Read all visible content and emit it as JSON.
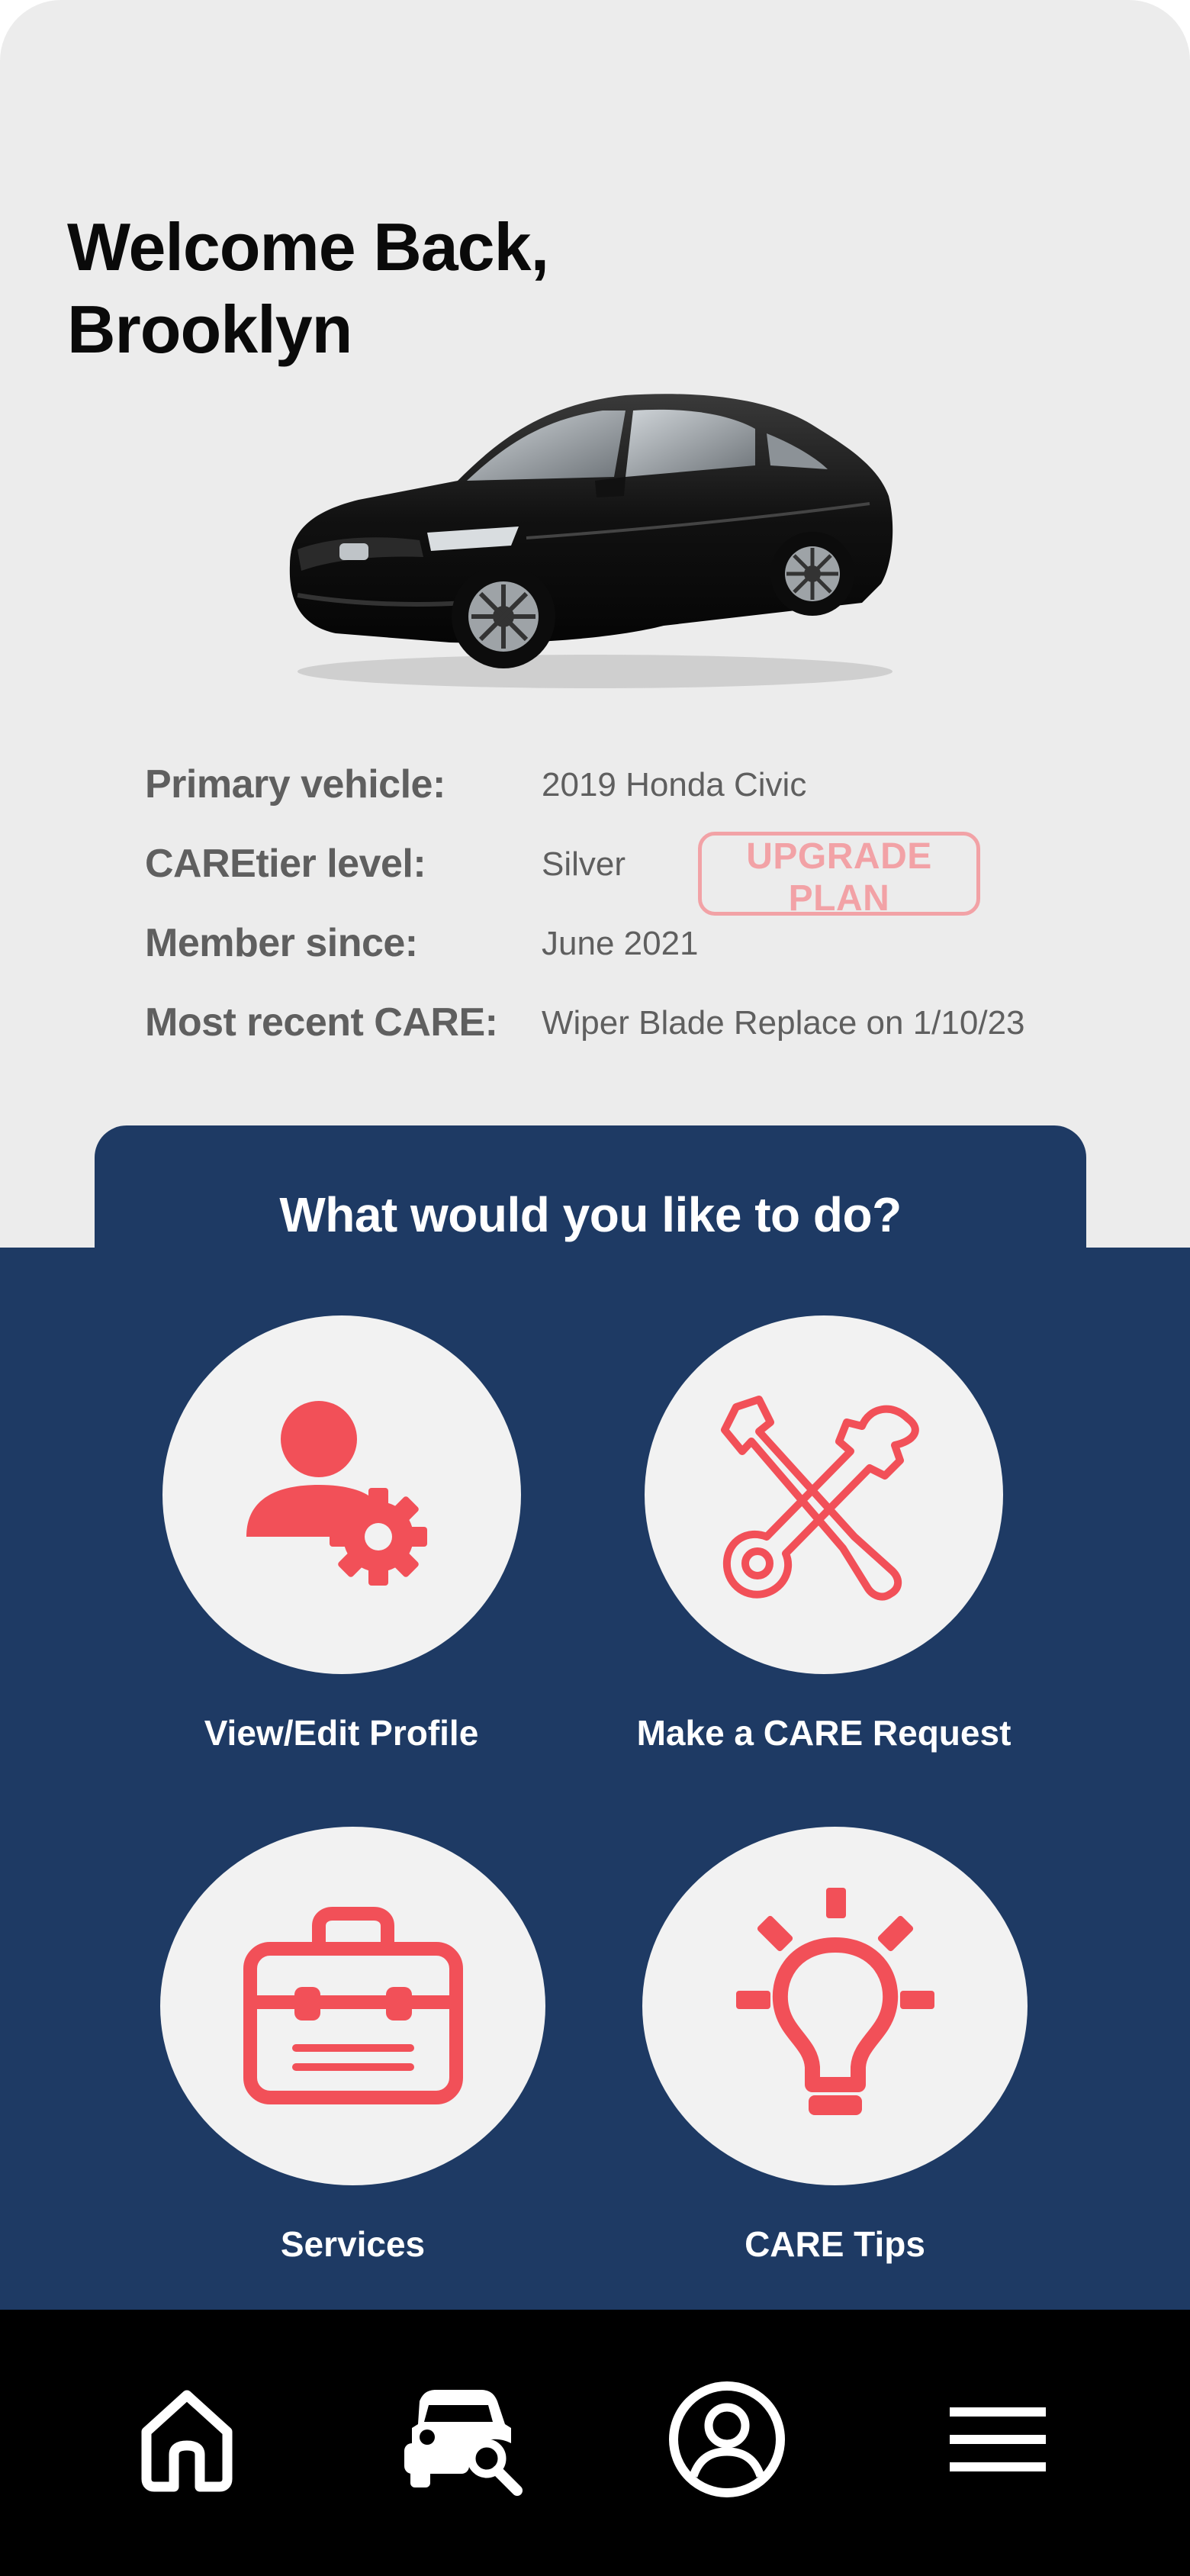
{
  "greeting": {
    "line1": "Welcome Back,",
    "line2": "Brooklyn"
  },
  "vehicle_info": {
    "rows": [
      {
        "label": "Primary vehicle:",
        "value": "2019 Honda Civic"
      },
      {
        "label": "CAREtier level:",
        "value": "Silver"
      },
      {
        "label": "Member since:",
        "value": "June 2021"
      },
      {
        "label": "Most recent CARE:",
        "value": "Wiper Blade Replace on 1/10/23"
      }
    ],
    "upgrade_label": "UPGRADE PLAN"
  },
  "actions": {
    "title": "What would you like to do?",
    "items": [
      {
        "label": "View/Edit Profile",
        "icon": "user-settings-icon"
      },
      {
        "label": "Make a CARE Request",
        "icon": "tools-icon"
      },
      {
        "label": "Services",
        "icon": "toolbox-icon"
      },
      {
        "label": "CARE Tips",
        "icon": "lightbulb-icon"
      }
    ]
  },
  "bottom_nav": {
    "items": [
      {
        "icon": "home-icon"
      },
      {
        "icon": "car-search-icon"
      },
      {
        "icon": "profile-icon"
      },
      {
        "icon": "menu-icon"
      }
    ]
  },
  "colors": {
    "background": "#ececec",
    "panel": "#1e3a64",
    "accent": "#f25058",
    "accent_light": "#f2a2a6",
    "nav": "#000000"
  }
}
